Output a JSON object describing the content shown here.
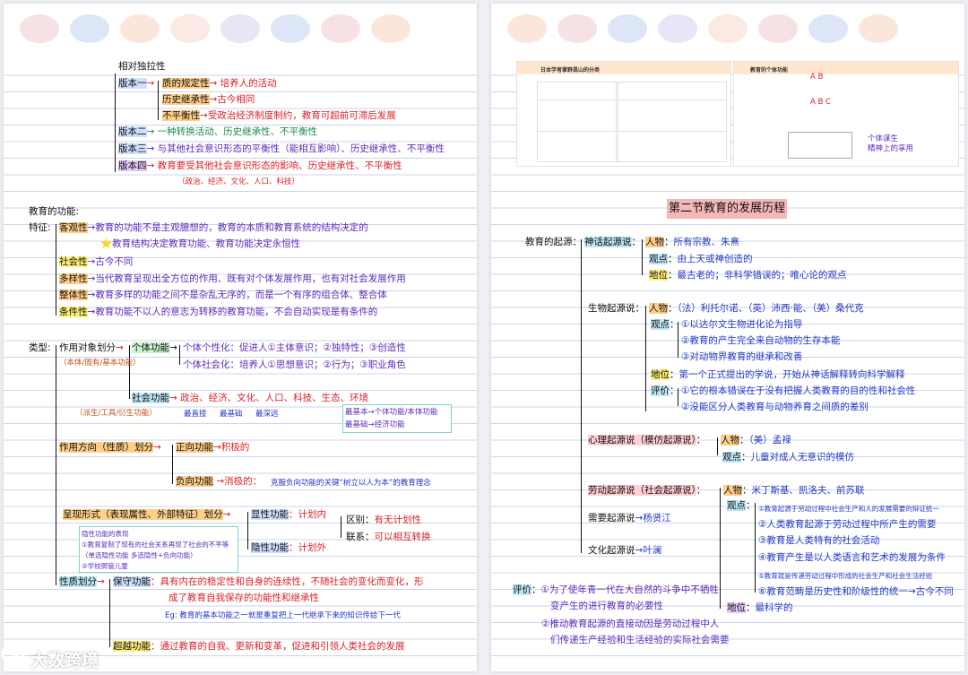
{
  "colors": {
    "red": "#d8232a",
    "purple": "#5b2bb8",
    "blue": "#2237c4",
    "orange_hl": "#ffcf8a",
    "yellow_hl": "#fff07a",
    "title_bg": "#f7b7b7"
  },
  "dots": [
    "#f6e1e4",
    "#dde6f7",
    "#fbe6dc",
    "#fbe9e4",
    "#e7e5f6",
    "#dde6f7",
    "#f6e1e4",
    "#fbe6dc",
    "#fbe9e4"
  ],
  "left": {
    "rel_indep": "相对独拉性",
    "v1": "版本一",
    "v1a": "质的规定性",
    "v1a_t": "培养人的活动",
    "v1b": "历史继承性",
    "v1b_t": "古今相同",
    "v1c": "不平衡性",
    "v1c_t": "受政治经济制度制约，教育可超前可滞后发展",
    "v2": "版本二",
    "v2_t": "一种转换活动、历史继承性、不平衡性",
    "v3": "版本三",
    "v3_t": "与其他社会意识形态的平衡性（能相互影响）、历史继承性、不平衡性",
    "v4": "版本四",
    "v4_t": "教育要受其他社会意识形态的影响、历史继承性、不平衡性",
    "v4_sub": "（政治、经济、文化、人口、科技）",
    "func_title": "教育的功能:",
    "feature": "特征:",
    "f1": "客观性",
    "f1_t": "教育的功能不是主观臆想的，教育的本质和教育系统的结构决定的",
    "f1_star": "教育结构决定教育功能、教育功能决定永恒性",
    "f2": "社会性",
    "f2_t": "古今不同",
    "f3": "多样性",
    "f3_t": "当代教育呈现出全方位的作用、既有对个体发展作用，也有对社会发展作用",
    "f4": "整体性",
    "f4_t": "教育多样的功能之间不是杂乱无序的，而是一个有序的组合体、整合体",
    "f5": "条件性",
    "f5_t": "教育功能不以人的意志为转移的教育功能，不会自动实现是有条件的",
    "type": "类型:",
    "obj": "作用对象划分",
    "indiv": "个体功能",
    "indiv_sub": "（本体/固有/基本功能）",
    "ind1": "个体个性化：促进人①主体意识；②独特性；③创造性",
    "ind2": "个体社会化：培养人①思想意识；②行为；③职业角色",
    "social": "社会功能",
    "social_t": "政治、经济、文化、人口、科技、生态、环境",
    "social_sub": "（派生/工具/衍生功能）",
    "tag1": "最直接",
    "tag2": "最基础",
    "tag3": "最深远",
    "note1": "最基本→个体功能/本体功能",
    "note2": "最基础→经济功能",
    "dir": "作用方向（性质）划分",
    "pos": "正向功能",
    "pos_t": "积极的",
    "neg": "负向功能",
    "neg_t": "消极的：",
    "neg_note": "克服负向功能的关键“树立以人为本”的教育理念",
    "form": "呈现形式（表现属性、外部特征）划分",
    "explicit": "显性功能",
    "explicit_t": "计划内",
    "implicit": "隐性功能",
    "implicit_t": "计划外",
    "diff": "区别",
    "diff_t": "有无计划性",
    "rel": "联系",
    "rel_t": "可以相互转换",
    "hid_title": "隐性功能的表现",
    "hid1": "①教育复制了现有的社会关系再现了社会的不平等",
    "hid1b": "（单选隐性功能 多选隐性+负向功能）",
    "hid2": "②学校照管儿童",
    "nature": "性质划分",
    "keep": "保守功能",
    "keep_t": "具有内在的稳定性和自身的连续性，不随社会的变化而变化，形",
    "keep_t2": "成了教育自我保存的功能性和继承性",
    "eg": "Eg: 教育的基本功能之一就是重复把上一代继承下来的知识传给下一代",
    "beyond": "超越功能",
    "beyond_t": "通过教育的自我、更新和变革，促进和引领人类社会的发展"
  },
  "right": {
    "thumb_left_title": "日本学者掌野昌山的分类",
    "thumb_right_title": "教育的个体功能",
    "ann1": "A B",
    "ann2": "A B C",
    "ann3": "个体谋生",
    "ann4": "精神上的享用",
    "section_title": "第二节教育的发展历程",
    "origin": "教育的起源",
    "myth": "神话起源说",
    "myth_person": "人物",
    "myth_person_t": "所有宗教、朱熹",
    "myth_view": "观点",
    "myth_view_t": "由上天或神创造的",
    "myth_status": "地位",
    "myth_status_t": "最古老的；非科学错误的；唯心论的观点",
    "bio": "生物起源说",
    "bio_person": "人物",
    "bio_person_t": "（法）利托尔诺、（英）沛西·能、（美）桑代克",
    "bio_view": "观点",
    "bio_v1": "①以达尔文生物进化论为指导",
    "bio_v2": "②教育的产生完全来自动物的生存本能",
    "bio_v3": "③对动物界教育的继承和改善",
    "bio_status": "地位",
    "bio_status_t": "第一个正式提出的学说，开始从神话解释转向科学解释",
    "bio_eval": "评价",
    "bio_e1": "①它的根本错误在于没有把握人类教育的目的性和社会性",
    "bio_e2": "②没能区分人类教育与动物养育之间质的差别",
    "psy": "心理起源说（模仿起源说）",
    "psy_person": "人物",
    "psy_person_t": "（美）孟禄",
    "psy_view": "观点",
    "psy_view_t": "儿童对成人无意识的模仿",
    "labor": "劳动起源说（社会起源说）",
    "labor_person": "人物",
    "labor_person_t": "米丁斯基、凯洛夫、前苏联",
    "labor_view": "观点",
    "need": "需要起源说",
    "need_t": "杨贤江",
    "culture": "文化起源说",
    "culture_t": "叶澜",
    "lv1": "①教育起源于劳动过程中社会生产和人的发展需要的辩证统一",
    "lv2": "②人类教育起源于劳动过程中所产生的需要",
    "lv3": "③教育是人类特有的社会活动",
    "lv4": "④教育产生是以人类语言和艺术的发展为条件",
    "lv5": "⑤教育就是传递劳动过程中形成的社会生产和社会生活经验",
    "lv6": "⑥教育范畴是历史性和阶级性的统一→古今不同",
    "labor_status": "地位",
    "labor_status_t": "最科学的",
    "eval": "评价",
    "eval1": "①为了使年青一代在大自然的斗争中不牺牲",
    "eval1b": "变产生的进行教育的必要性",
    "eval2": "②推动教育起源的直接动因是劳动过程中人",
    "eval2b": "们传递生产经验和生活经验的实际社会需要"
  },
  "watermark": "大数跨境"
}
